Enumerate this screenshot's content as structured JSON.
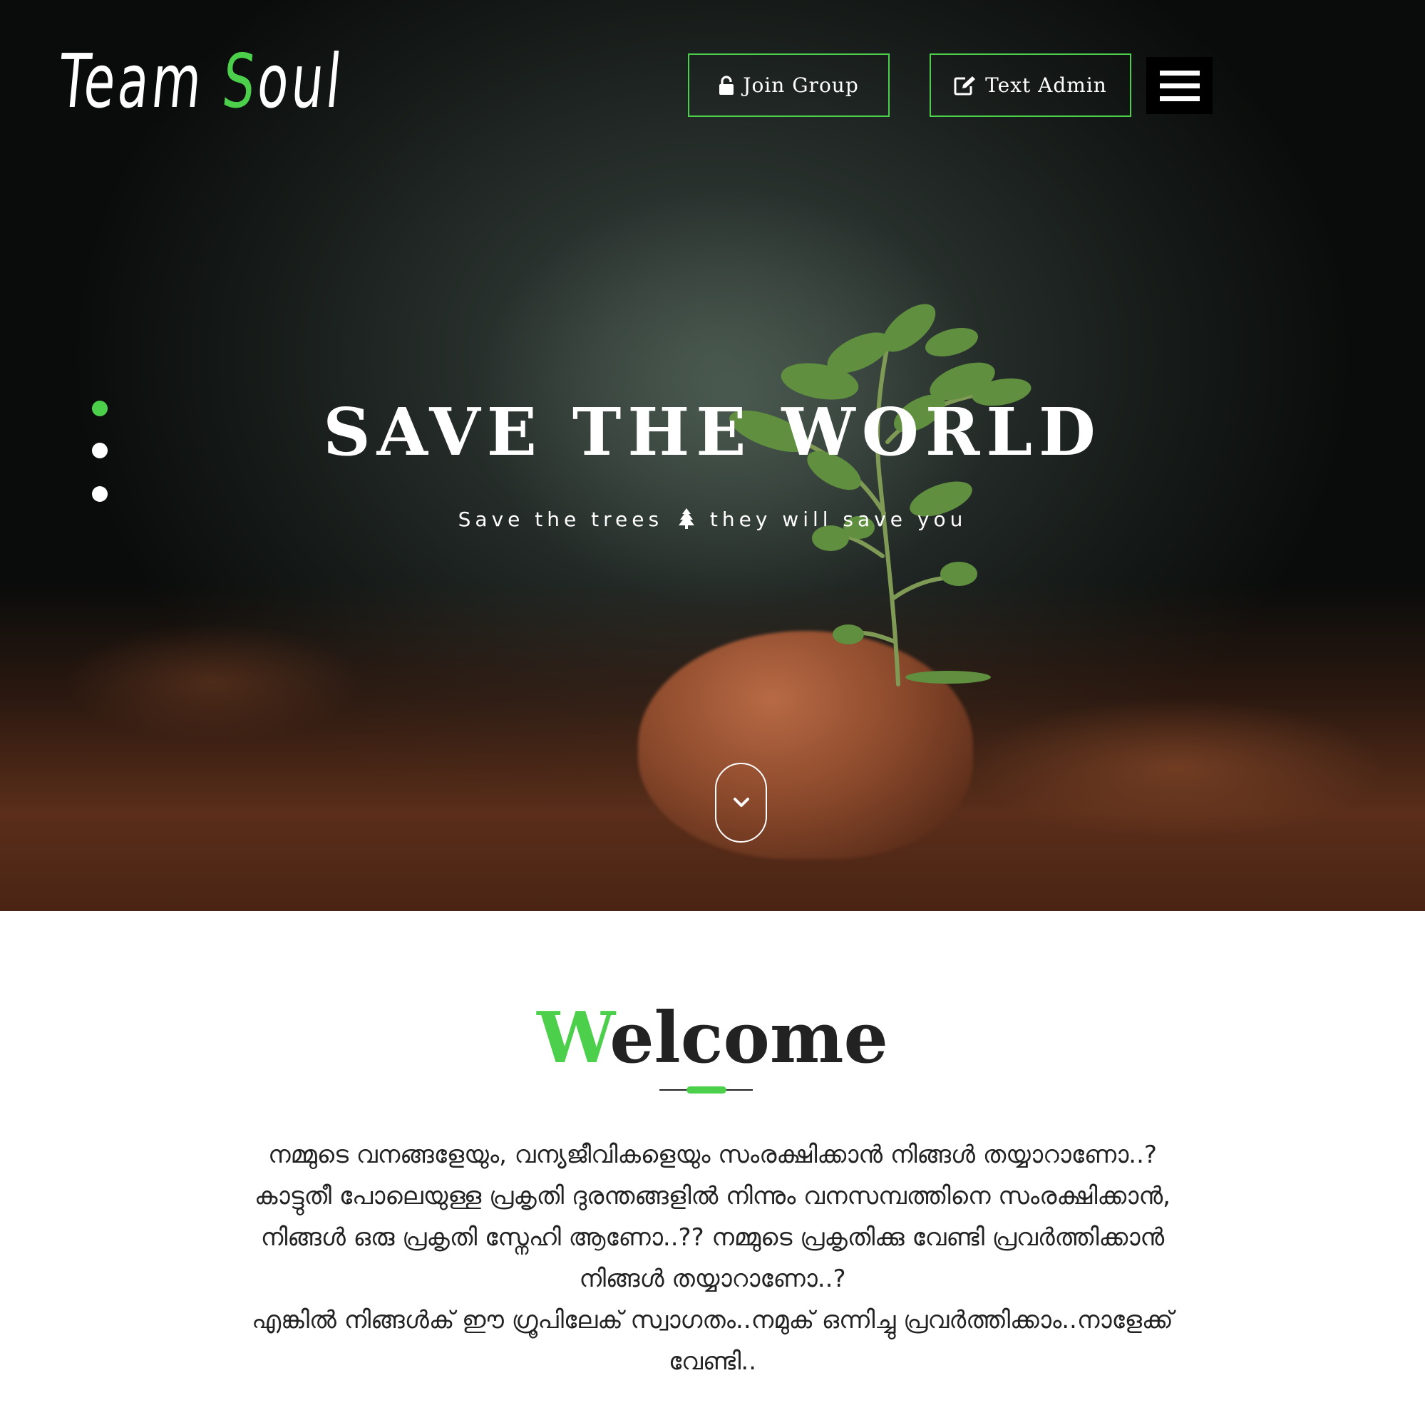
{
  "header": {
    "logo_part1": "Team ",
    "logo_accent": "S",
    "logo_part2": "oul",
    "join_label": "Join Group",
    "admin_label": "Text Admin"
  },
  "hero": {
    "title": "SAVE THE WORLD",
    "subtitle_before": "Save the trees",
    "subtitle_after": "they will save you",
    "slide_count": 3,
    "active_slide": 1
  },
  "welcome": {
    "title_accent": "W",
    "title_rest": "elcome",
    "lines": [
      "നമ്മുടെ വനങ്ങളേയും, വന്യജീവികളെയും സംരക്ഷിക്കാൻ നിങ്ങൾ തയ്യാറാണോ..?",
      "കാട്ടുതീ പോലെയുള്ള പ്രകൃതി ദുരന്തങ്ങളിൽ നിന്നും വനസമ്പത്തിനെ സംരക്ഷിക്കാൻ,",
      "നിങ്ങൾ ഒരു പ്രകൃതി സ്നേഹി ആണോ..?? നമ്മുടെ പ്രകൃതിക്കു വേണ്ടി പ്രവർത്തിക്കാൻ",
      "നിങ്ങൾ തയ്യാറാണോ..?",
      "എങ്കിൽ നിങ്ങൾക് ഈ ഗ്രൂപിലേക് സ്വാഗതം..നമുക് ഒന്നിച്ചു പ്രവർത്തിക്കാം..നാളേക്ക്",
      "വേണ്ടി.."
    ]
  },
  "icons": {
    "join": "unlock-icon",
    "admin": "edit-icon",
    "menu": "hamburger-menu-icon",
    "subtitle": "tree-icon",
    "scroll": "chevron-down-icon"
  },
  "colors": {
    "accent": "#4cd04c",
    "text_dark": "#222222",
    "menu_bg": "#000000"
  }
}
